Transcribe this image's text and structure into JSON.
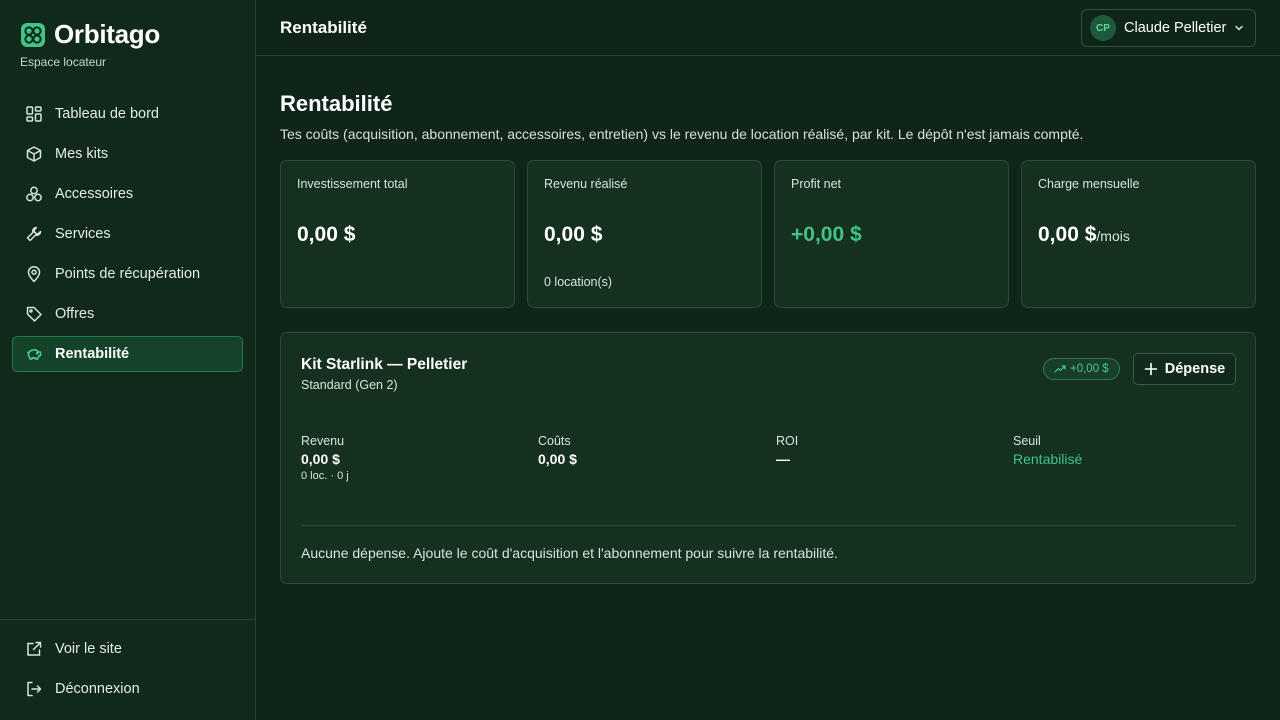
{
  "brand": {
    "name": "Orbitago",
    "subtitle": "Espace locateur"
  },
  "sidebar": {
    "items": [
      {
        "label": "Tableau de bord",
        "icon": "dashboard-icon"
      },
      {
        "label": "Mes kits",
        "icon": "box-icon"
      },
      {
        "label": "Accessoires",
        "icon": "accessories-icon"
      },
      {
        "label": "Services",
        "icon": "wrench-icon"
      },
      {
        "label": "Points de récupération",
        "icon": "map-pin-icon"
      },
      {
        "label": "Offres",
        "icon": "tag-icon"
      },
      {
        "label": "Rentabilité",
        "icon": "piggy-bank-icon",
        "active": true
      }
    ],
    "bottom": [
      {
        "label": "Voir le site",
        "icon": "external-link-icon"
      },
      {
        "label": "Déconnexion",
        "icon": "logout-icon"
      }
    ]
  },
  "header": {
    "title": "Rentabilité",
    "user": {
      "initials": "CP",
      "name": "Claude Pelletier"
    }
  },
  "page": {
    "title": "Rentabilité",
    "subtitle": "Tes coûts (acquisition, abonnement, accessoires, entretien) vs le revenu de location réalisé, par kit. Le dépôt n'est jamais compté."
  },
  "stats": [
    {
      "label": "Investissement total",
      "value": "0,00 $",
      "unit": "",
      "note": ""
    },
    {
      "label": "Revenu réalisé",
      "value": "0,00 $",
      "unit": "",
      "note": "0 location(s)"
    },
    {
      "label": "Profit net",
      "value": "+0,00 $",
      "unit": "",
      "note": ""
    },
    {
      "label": "Charge mensuelle",
      "value": "0,00 $",
      "unit": "/mois",
      "note": ""
    }
  ],
  "kit": {
    "name": "Kit Starlink — Pelletier",
    "model": "Standard (Gen 2)",
    "badge": "+0,00 $",
    "expense_button": "Dépense",
    "metrics": {
      "revenue": {
        "label": "Revenu",
        "value": "0,00 $",
        "sub": "0 loc. · 0 j"
      },
      "costs": {
        "label": "Coûts",
        "value": "0,00 $"
      },
      "roi": {
        "label": "ROI",
        "value": "—"
      },
      "threshold": {
        "label": "Seuil",
        "value": "Rentabilisé"
      }
    },
    "empty_message": "Aucune dépense. Ajoute le coût d'acquisition et l'abonnement pour suivre la rentabilité."
  },
  "colors": {
    "background": "#0f2519",
    "sidebar": "#10291b",
    "card": "#15301f",
    "accent": "#3fc485",
    "active_nav": "#15432a"
  }
}
